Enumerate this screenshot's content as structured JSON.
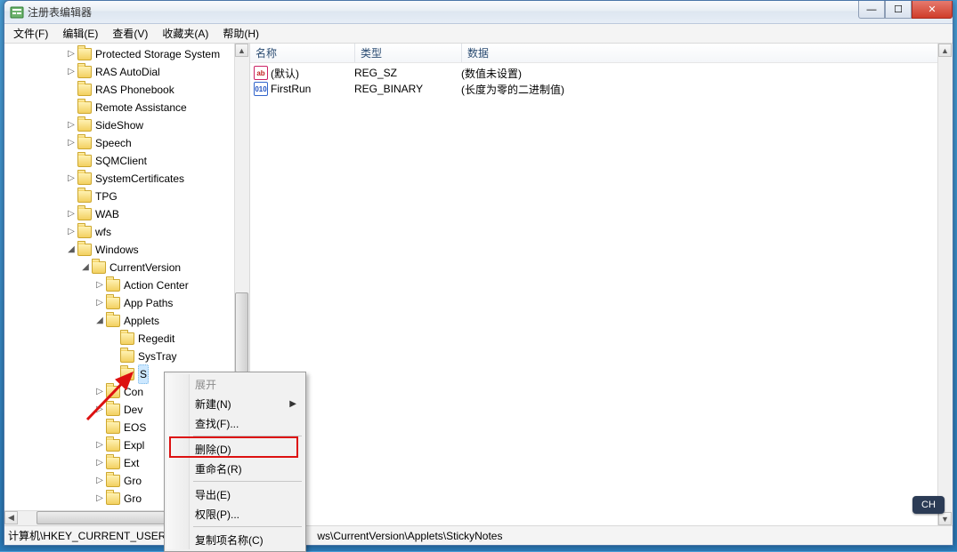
{
  "window": {
    "title": "注册表编辑器"
  },
  "menubar": {
    "file": "文件(F)",
    "edit": "编辑(E)",
    "view": "查看(V)",
    "favorites": "收藏夹(A)",
    "help": "帮助(H)"
  },
  "tree": {
    "items": [
      {
        "indent": 4,
        "exp": "▷",
        "label": "Protected Storage System"
      },
      {
        "indent": 4,
        "exp": "▷",
        "label": "RAS AutoDial"
      },
      {
        "indent": 4,
        "exp": "",
        "label": "RAS Phonebook"
      },
      {
        "indent": 4,
        "exp": "",
        "label": "Remote Assistance"
      },
      {
        "indent": 4,
        "exp": "▷",
        "label": "SideShow"
      },
      {
        "indent": 4,
        "exp": "▷",
        "label": "Speech"
      },
      {
        "indent": 4,
        "exp": "",
        "label": "SQMClient"
      },
      {
        "indent": 4,
        "exp": "▷",
        "label": "SystemCertificates"
      },
      {
        "indent": 4,
        "exp": "",
        "label": "TPG"
      },
      {
        "indent": 4,
        "exp": "▷",
        "label": "WAB"
      },
      {
        "indent": 4,
        "exp": "▷",
        "label": "wfs"
      },
      {
        "indent": 4,
        "exp": "◢",
        "label": "Windows"
      },
      {
        "indent": 5,
        "exp": "◢",
        "label": "CurrentVersion"
      },
      {
        "indent": 6,
        "exp": "▷",
        "label": "Action Center"
      },
      {
        "indent": 6,
        "exp": "▷",
        "label": "App Paths"
      },
      {
        "indent": 6,
        "exp": "◢",
        "label": "Applets"
      },
      {
        "indent": 7,
        "exp": "",
        "label": "Regedit"
      },
      {
        "indent": 7,
        "exp": "",
        "label": "SysTray"
      },
      {
        "indent": 7,
        "exp": "",
        "label": "S",
        "selected": true
      },
      {
        "indent": 6,
        "exp": "▷",
        "label": "Con"
      },
      {
        "indent": 6,
        "exp": "▷",
        "label": "Dev"
      },
      {
        "indent": 6,
        "exp": "",
        "label": "EOS"
      },
      {
        "indent": 6,
        "exp": "▷",
        "label": "Expl"
      },
      {
        "indent": 6,
        "exp": "▷",
        "label": "Ext"
      },
      {
        "indent": 6,
        "exp": "▷",
        "label": "Gro"
      },
      {
        "indent": 6,
        "exp": "▷",
        "label": "Gro"
      }
    ]
  },
  "list": {
    "headers": {
      "name": "名称",
      "type": "类型",
      "data": "数据"
    },
    "rows": [
      {
        "icon": "sz",
        "iconText": "ab",
        "name": "(默认)",
        "type": "REG_SZ",
        "data": "(数值未设置)"
      },
      {
        "icon": "bin",
        "iconText": "010",
        "name": "FirstRun",
        "type": "REG_BINARY",
        "data": "(长度为零的二进制值)"
      }
    ]
  },
  "context_menu": {
    "expand": "展开",
    "new": "新建(N)",
    "find": "查找(F)...",
    "delete": "删除(D)",
    "rename": "重命名(R)",
    "export": "导出(E)",
    "permissions": "权限(P)...",
    "copy_key_name": "复制项名称(C)"
  },
  "statusbar": {
    "path_left": "计算机\\HKEY_CURRENT_USER",
    "path_right": "ws\\CurrentVersion\\Applets\\StickyNotes"
  },
  "ime": {
    "label": "CH"
  }
}
